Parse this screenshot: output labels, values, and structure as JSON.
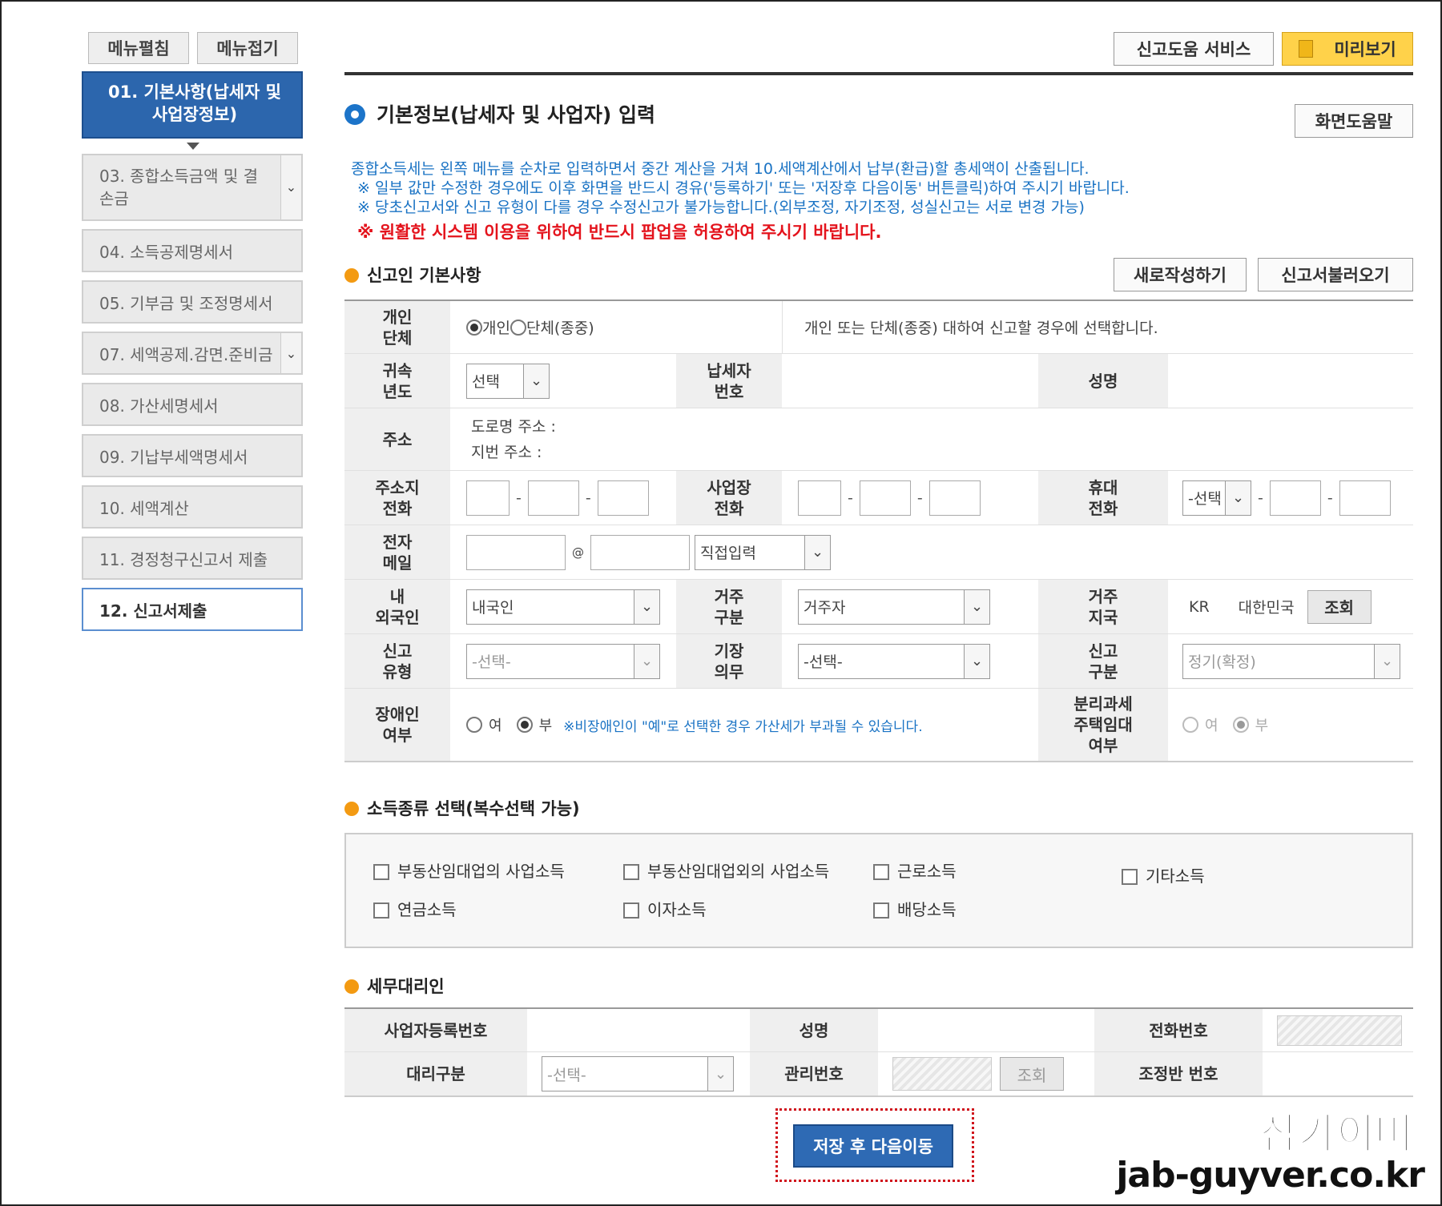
{
  "sidebar": {
    "top_buttons": [
      "메뉴펼침",
      "메뉴접기"
    ],
    "items": [
      {
        "label": "01. 기본사항(납세자 및 사업장정보)",
        "state": "active"
      },
      {
        "label": "03. 종합소득금액 및 결손금"
      },
      {
        "label": "04. 소득공제명세서"
      },
      {
        "label": "05. 기부금 및 조정명세서"
      },
      {
        "label": "07. 세액공제.감면.준비금"
      },
      {
        "label": "08. 가산세명세서"
      },
      {
        "label": "09. 기납부세액명세서"
      },
      {
        "label": "10. 세액계산"
      },
      {
        "label": "11. 경정청구신고서 제출"
      },
      {
        "label": "12. 신고서제출"
      }
    ]
  },
  "header": {
    "help_service": "신고도움 서비스",
    "preview": "미리보기",
    "title": "기본정보(납세자 및 사업자) 입력",
    "screen_help": "화면도움말",
    "info_lines": [
      "종합소득세는 왼쪽 메뉴를 순차로 입력하면서 중간 계산을 거쳐 10.세액계산에서 납부(환급)할 총세액이 산출됩니다.",
      "※ 일부 값만 수정한 경우에도 이후 화면을 반드시 경유('등록하기' 또는 '저장후 다음이동' 버튼클릭)하여 주시기 바랍니다.",
      "※ 당초신고서와 신고 유형이 다를 경우 수정신고가 불가능합니다.(외부조정, 자기조정, 성실신고는 서로 변경 가능)"
    ],
    "warning": "※ 원활한 시스템 이용을 위하여 반드시 팝업을 허용하여 주시기 바랍니다."
  },
  "reporter": {
    "section_title": "신고인 기본사항",
    "new_button": "새로작성하기",
    "load_button": "신고서불러오기",
    "type_label": "개인\n단체",
    "type_individual": "개인",
    "type_group": "단체(종중)",
    "type_desc": "개인 또는 단체(종중) 대하여 신고할 경우에 선택합니다.",
    "year_label": "귀속\n년도",
    "year_value": "선택",
    "taxpayer_no_label": "납세자\n번호",
    "name_label": "성명",
    "address_label": "주소",
    "road_address": "도로명 주소 :",
    "lot_address": "지번 주소 :",
    "home_phone_label": "주소지\n전화",
    "biz_phone_label": "사업장\n전화",
    "mobile_label": "휴대\n전화",
    "mobile_select": "-선택",
    "email_label": "전자\n메일",
    "email_at": "@",
    "email_domain": "직접입력",
    "foreign_label": "내\n외국인",
    "foreign_value": "내국인",
    "residence_label": "거주\n구분",
    "residence_value": "거주자",
    "country_label": "거주\n지국",
    "country_code": "KR",
    "country_name": "대한민국",
    "lookup": "조회",
    "report_type_label": "신고\n유형",
    "report_type_value": "-선택-",
    "bookkeeping_label": "기장\n의무",
    "bookkeeping_value": "-선택-",
    "report_div_label": "신고\n구분",
    "report_div_value": "정기(확정)",
    "disabled_label": "장애인\n여부",
    "yes": "여",
    "no": "부",
    "disabled_note": "※비장애인이 \"예\"로 선택한 경우 가산세가 부과될 수 있습니다.",
    "separate_tax_label": "분리과세\n주택임대\n여부"
  },
  "income": {
    "section_title": "소득종류 선택(복수선택 가능)",
    "options": [
      "부동산임대업의 사업소득",
      "부동산임대업외의 사업소득",
      "근로소득",
      "기타소득",
      "연금소득",
      "이자소득",
      "배당소득"
    ]
  },
  "agent": {
    "section_title": "세무대리인",
    "biz_no_label": "사업자등록번호",
    "name_label": "성명",
    "phone_label": "전화번호",
    "type_label": "대리구분",
    "type_value": "-선택-",
    "mgmt_no_label": "관리번호",
    "lookup": "조회",
    "team_no_label": "조정반 번호"
  },
  "save_button": "저장 후 다음이동",
  "watermark": {
    "name": "잡가이버",
    "url": "jab-guyver.co.kr"
  }
}
